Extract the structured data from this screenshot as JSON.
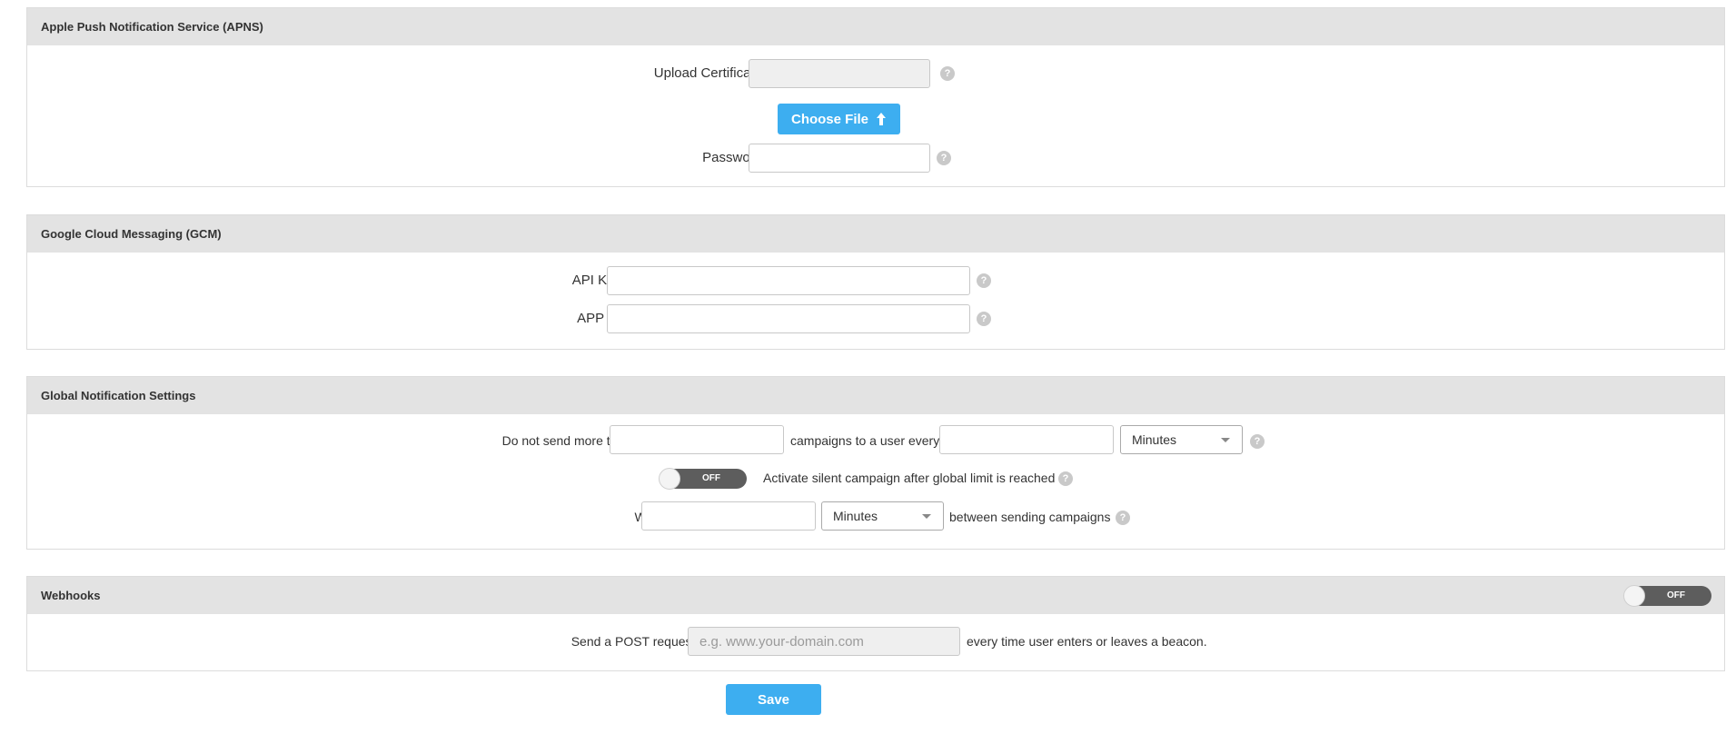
{
  "apns": {
    "title": "Apple Push Notification Service (APNS)",
    "upload_label": "Upload Certificate",
    "upload_value": "",
    "choose_file_label": "Choose File",
    "password_label": "Password",
    "password_value": "",
    "help_glyph": "?"
  },
  "gcm": {
    "title": "Google Cloud Messaging (GCM)",
    "api_key_label": "API Key",
    "api_key_value": "",
    "app_id_label": "APP ID",
    "app_id_value": ""
  },
  "global": {
    "title": "Global Notification Settings",
    "send_more_prefix": "Do not send more than",
    "campaigns_middle": "campaigns to a user every",
    "campaigns_count_value": "",
    "interval_value": "",
    "interval_unit": "Minutes",
    "silent_toggle_state": "OFF",
    "silent_label": "Activate silent campaign after global limit is reached",
    "wait_prefix": "Wait",
    "wait_value": "",
    "wait_unit": "Minutes",
    "wait_suffix": "between sending campaigns"
  },
  "webhooks": {
    "title": "Webhooks",
    "toggle_state": "OFF",
    "post_prefix": "Send a POST request to",
    "url_placeholder": "e.g. www.your-domain.com",
    "post_suffix": "every time user enters or leaves a beacon."
  },
  "save_label": "Save",
  "colors": {
    "primary_button": "#3daef0",
    "header_bg": "#e3e3e3",
    "toggle_off": "#5d5d5d",
    "help_icon": "#c9c9c9"
  },
  "icons": {
    "upload": "upload-arrow-icon",
    "help": "question-circle-icon",
    "dropdown": "caret-down-icon"
  }
}
